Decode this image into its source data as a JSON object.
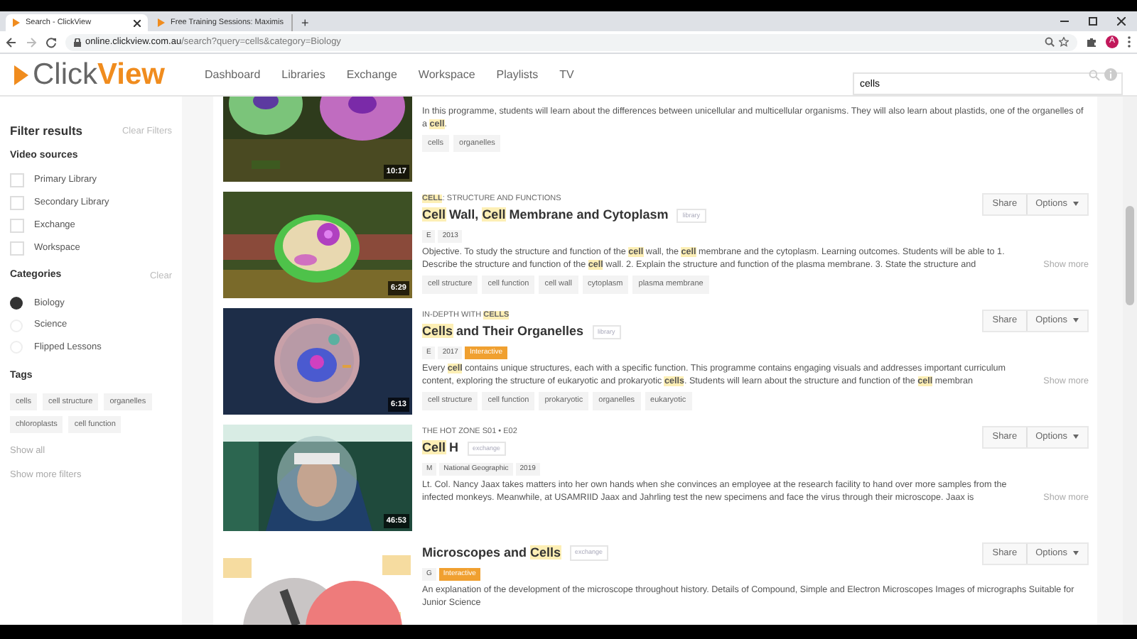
{
  "browser": {
    "tabs": [
      {
        "title": "Search - ClickView",
        "selected": true
      },
      {
        "title": "Free Training Sessions: Maximis",
        "selected": false
      }
    ],
    "new_tab": "+",
    "url_host": "online.clickview.com.au",
    "url_path": "/search?query=cells&category=Biology",
    "avatar": "A"
  },
  "header": {
    "logo_prefix": "Click",
    "logo_suffix": "View",
    "nav": [
      "Dashboard",
      "Libraries",
      "Exchange",
      "Workspace",
      "Playlists",
      "TV"
    ],
    "search_value": "cells"
  },
  "sidebar": {
    "title": "Filter results",
    "clear_filters": "Clear Filters",
    "video_sources_title": "Video sources",
    "video_sources": [
      {
        "label": "Primary Library",
        "checked": false
      },
      {
        "label": "Secondary Library",
        "checked": false
      },
      {
        "label": "Exchange",
        "checked": false
      },
      {
        "label": "Workspace",
        "checked": false
      }
    ],
    "categories_title": "Categories",
    "clear": "Clear",
    "categories": [
      {
        "label": "Biology",
        "selected": true
      },
      {
        "label": "Science",
        "selected": false
      },
      {
        "label": "Flipped Lessons",
        "selected": false
      }
    ],
    "tags_title": "Tags",
    "tags": [
      "cells",
      "cell structure",
      "organelles",
      "chloroplasts",
      "cell function"
    ],
    "show_all": "Show all",
    "show_more_filters": "Show more filters"
  },
  "results": [
    {
      "duration": "10:17",
      "description": "In this programme, students will learn about the differences between unicellular and multicellular organisms. They will also learn about plastids, one of the organelles of a **cell**.",
      "tags": [
        "cells",
        "organelles"
      ]
    },
    {
      "duration": "6:29",
      "series": "**CELL**: STRUCTURE AND FUNCTIONS",
      "title": "**Cell** Wall, **Cell** Membrane and Cytoplasm",
      "source": "library",
      "meta": [
        {
          "text": "E",
          "kind": "plain"
        },
        {
          "text": "2013",
          "kind": "plain"
        }
      ],
      "description": "Objective. To study the structure and function of the **cell** wall, the **cell** membrane and the cytoplasm. Learning outcomes. Students will be able to 1. Describe the structure and function of the **cell** wall. 2. Explain the structure and function of the plasma membrane. 3. State the structure and",
      "show_more": "Show more",
      "tags": [
        "cell structure",
        "cell function",
        "cell wall",
        "cytoplasm",
        "plasma membrane"
      ],
      "share": "Share",
      "options": "Options"
    },
    {
      "duration": "6:13",
      "series": "IN-DEPTH WITH **CELLS**",
      "title": "**Cells** and Their Organelles",
      "source": "library",
      "meta": [
        {
          "text": "E",
          "kind": "plain"
        },
        {
          "text": "2017",
          "kind": "plain"
        },
        {
          "text": "Interactive",
          "kind": "interactive"
        }
      ],
      "description": "Every **cell** contains unique structures, each with a specific function. This programme contains engaging visuals and addresses important curriculum content, exploring the structure of eukaryotic and prokaryotic **cells**. Students will learn about the structure and function of the **cell** membran",
      "show_more": "Show more",
      "tags": [
        "cell structure",
        "cell function",
        "prokaryotic",
        "organelles",
        "eukaryotic"
      ],
      "share": "Share",
      "options": "Options"
    },
    {
      "duration": "46:53",
      "series": "THE HOT ZONE  S01 • E02",
      "title": "**Cell** H",
      "source": "exchange",
      "meta": [
        {
          "text": "M",
          "kind": "plain"
        },
        {
          "text": "National Geographic",
          "kind": "plain"
        },
        {
          "text": "2019",
          "kind": "plain"
        }
      ],
      "description": "Lt. Col. Nancy Jaax takes matters into her own hands when she convinces an employee at the research facility to hand over more samples from the infected monkeys. Meanwhile, at USAMRIID Jaax and Jahrling test the new specimens and face the virus through their microscope. Jaax is",
      "show_more": "Show more",
      "share": "Share",
      "options": "Options"
    },
    {
      "title": "Microscopes and **Cells**",
      "source": "exchange",
      "meta": [
        {
          "text": "G",
          "kind": "plain"
        },
        {
          "text": "Interactive",
          "kind": "interactive"
        }
      ],
      "description": "An explanation of the development of the microscope throughout history. Details of Compound, Simple and Electron Microscopes Images of micrographs Suitable for Junior Science",
      "share": "Share",
      "options": "Options"
    }
  ]
}
